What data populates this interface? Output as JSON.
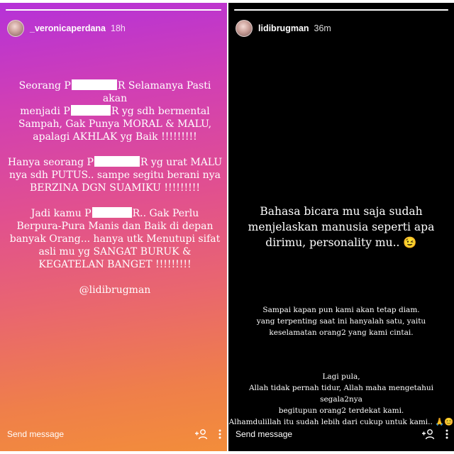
{
  "left_story": {
    "username": "_veronicaperdana",
    "time": "18h",
    "progress": 1.0,
    "paragraphs": [
      {
        "lines": [
          [
            "Seorang P",
            "[censored]",
            "R Selamanya Pasti akan"
          ],
          [
            "menjadi P",
            "[censored]",
            "R yg sdh bermental"
          ],
          [
            "Sampah, Gak Punya MORAL & MALU,"
          ],
          [
            "apalagi AKHLAK yg Baik !!!!!!!!!"
          ]
        ]
      },
      {
        "lines": [
          [
            "Hanya seorang P",
            "[censored]",
            "R yg urat MALU"
          ],
          [
            "nya sdh PUTUS.. sampe segitu berani nya"
          ],
          [
            "BERZINA DGN SUAMIKU !!!!!!!!!"
          ]
        ]
      },
      {
        "lines": [
          [
            "Jadi kamu P",
            "[censored]",
            "R.. Gak Perlu"
          ],
          [
            "Berpura-Pura Manis dan Baik di depan"
          ],
          [
            "banyak Orang... hanya utk Menutupi sifat"
          ],
          [
            "asli mu yg SANGAT BURUK &"
          ],
          [
            "KEGATELAN BANGET !!!!!!!!!"
          ]
        ]
      }
    ],
    "mention": "@lidibrugman",
    "send_message": "Send message"
  },
  "right_story": {
    "username": "lidibrugman",
    "time": "36m",
    "progress": 1.0,
    "main_lines": [
      "Bahasa bicara mu saja sudah",
      "menjelaskan manusia seperti apa",
      "dirimu, personality mu.."
    ],
    "main_emoji": "😉",
    "sub_lines": [
      "Sampai kapan pun kami akan tetap diam.",
      "yang terpenting saat ini hanyalah satu, yaitu",
      "keselamatan orang2 yang kami cintai."
    ],
    "sub2_lines": [
      "Lagi pula,",
      "Allah tidak pernah tidur, Allah maha mengetahui segala2nya",
      "begitupun orang2 terdekat kami.",
      "Alhamdulillah itu sudah lebih dari cukup untuk kami.."
    ],
    "sub2_emojis": "🙏😊",
    "send_message": "Send message"
  },
  "icons": {
    "add_person": "add-person-icon",
    "more": "more-options-icon",
    "wink": "winking-face-emoji",
    "pray": "folded-hands-emoji",
    "smile": "smiling-face-emoji"
  }
}
